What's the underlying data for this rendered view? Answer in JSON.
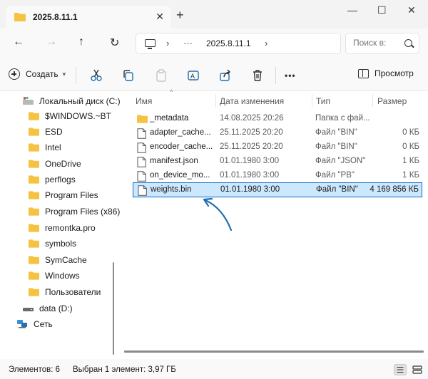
{
  "tab": {
    "title": "2025.8.11.1",
    "close": "✕",
    "new_tab": "+"
  },
  "window_controls": {
    "minimize": "—",
    "maximize": "☐",
    "close": "✕"
  },
  "nav_buttons": {
    "back": "←",
    "forward": "→",
    "up": "↑",
    "refresh": "↻"
  },
  "address": {
    "chevron": "›",
    "ellipsis": "···",
    "crumb": "2025.8.11.1"
  },
  "search": {
    "placeholder": "Поиск в:"
  },
  "toolbar": {
    "create_label": "Создать",
    "more": "•••",
    "preview_label": "Просмотр"
  },
  "sidebar": {
    "items": [
      {
        "label": "Локальный диск (C:)",
        "icon": "drive-icon"
      },
      {
        "label": "$WINDOWS.~BT",
        "icon": "folder-icon"
      },
      {
        "label": "ESD",
        "icon": "folder-icon"
      },
      {
        "label": "Intel",
        "icon": "folder-icon"
      },
      {
        "label": "OneDrive",
        "icon": "folder-icon"
      },
      {
        "label": "perflogs",
        "icon": "folder-icon"
      },
      {
        "label": "Program Files",
        "icon": "folder-icon"
      },
      {
        "label": "Program Files (x86)",
        "icon": "folder-icon"
      },
      {
        "label": "remontka.pro",
        "icon": "folder-icon"
      },
      {
        "label": "symbols",
        "icon": "folder-icon"
      },
      {
        "label": "SymCache",
        "icon": "folder-icon"
      },
      {
        "label": "Windows",
        "icon": "folder-icon"
      },
      {
        "label": "Пользователи",
        "icon": "folder-icon"
      },
      {
        "label": "data (D:)",
        "icon": "drive-icon"
      },
      {
        "label": "Сеть",
        "icon": "network-icon"
      }
    ]
  },
  "columns": {
    "name": "Имя",
    "date": "Дата изменения",
    "type": "Тип",
    "size": "Размер"
  },
  "files": [
    {
      "name": "_metadata",
      "date": "14.08.2025 20:26",
      "type": "Папка с фай...",
      "size": "",
      "icon": "folder-icon"
    },
    {
      "name": "adapter_cache...",
      "date": "25.11.2025 20:20",
      "type": "Файл \"BIN\"",
      "size": "0 КБ",
      "icon": "file-icon"
    },
    {
      "name": "encoder_cache...",
      "date": "25.11.2025 20:20",
      "type": "Файл \"BIN\"",
      "size": "0 КБ",
      "icon": "file-icon"
    },
    {
      "name": "manifest.json",
      "date": "01.01.1980 3:00",
      "type": "Файл \"JSON\"",
      "size": "1 КБ",
      "icon": "file-icon"
    },
    {
      "name": "on_device_mo...",
      "date": "01.01.1980 3:00",
      "type": "Файл \"PB\"",
      "size": "1 КБ",
      "icon": "file-icon"
    },
    {
      "name": "weights.bin",
      "date": "01.01.1980 3:00",
      "type": "Файл \"BIN\"",
      "size": "4 169 856 КБ",
      "icon": "file-icon",
      "selected": true
    }
  ],
  "status": {
    "count": "Элементов: 6",
    "selection": "Выбран 1 элемент: 3,97 ГБ"
  },
  "colors": {
    "folder": "#f5c242",
    "selection_bg": "#cce8ff",
    "selection_border": "#0a66c2",
    "arrow": "#1f6fb0"
  }
}
